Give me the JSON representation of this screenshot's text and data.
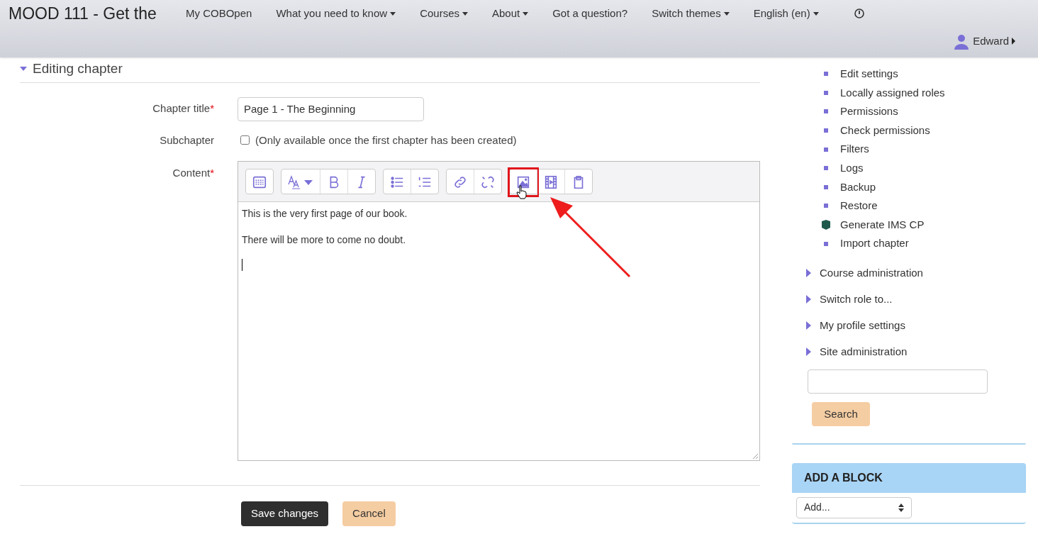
{
  "header": {
    "site_title": "MOOD 111 - Get the",
    "nav": [
      {
        "label": "My COBOpen",
        "dropdown": false
      },
      {
        "label": "What you need to know",
        "dropdown": true
      },
      {
        "label": "Courses",
        "dropdown": true
      },
      {
        "label": "About",
        "dropdown": true
      },
      {
        "label": "Got a question?",
        "dropdown": false
      },
      {
        "label": "Switch themes",
        "dropdown": true
      },
      {
        "label": "English (en)",
        "dropdown": true
      }
    ],
    "user": {
      "name": "Edward"
    }
  },
  "heading": "Editing chapter",
  "form": {
    "chapter_title": {
      "label": "Chapter title",
      "required_mark": "*",
      "value": "Page 1 - The Beginning"
    },
    "subchapter": {
      "label": "Subchapter",
      "checked": false,
      "note": "(Only available once the first chapter has been created)"
    },
    "content": {
      "label": "Content",
      "required_mark": "*",
      "toolbar": [
        [
          {
            "kind": "toggle",
            "highlighted": false
          }
        ],
        [
          {
            "kind": "style",
            "highlighted": false
          },
          {
            "kind": "bold",
            "highlighted": false
          },
          {
            "kind": "italic",
            "highlighted": false
          }
        ],
        [
          {
            "kind": "bullets",
            "highlighted": false
          },
          {
            "kind": "numbers",
            "highlighted": false
          }
        ],
        [
          {
            "kind": "link",
            "highlighted": false
          },
          {
            "kind": "unlink",
            "highlighted": false
          }
        ],
        [
          {
            "kind": "image",
            "highlighted": true
          },
          {
            "kind": "media",
            "highlighted": false
          },
          {
            "kind": "file",
            "highlighted": false
          }
        ]
      ],
      "paragraphs": [
        "This is the very first page of our book.",
        "There will be more to come no doubt."
      ]
    },
    "buttons": [
      {
        "label": "Save changes",
        "kind": "primary"
      },
      {
        "label": "Cancel",
        "kind": "secondary"
      }
    ]
  },
  "sidebar": {
    "items": [
      {
        "label": "Edit settings",
        "kind": "bullet"
      },
      {
        "label": "Locally assigned roles",
        "kind": "bullet"
      },
      {
        "label": "Permissions",
        "kind": "bullet"
      },
      {
        "label": "Check permissions",
        "kind": "bullet"
      },
      {
        "label": "Filters",
        "kind": "bullet"
      },
      {
        "label": "Logs",
        "kind": "bullet"
      },
      {
        "label": "Backup",
        "kind": "bullet"
      },
      {
        "label": "Restore",
        "kind": "bullet"
      },
      {
        "label": "Generate IMS CP",
        "kind": "package"
      },
      {
        "label": "Import chapter",
        "kind": "bullet"
      }
    ],
    "sections": [
      {
        "label": "Course administration",
        "expanded": false
      },
      {
        "label": "Switch role to...",
        "expanded": false
      },
      {
        "label": "My profile settings",
        "expanded": false
      },
      {
        "label": "Site administration",
        "expanded": false
      }
    ],
    "search_button": "Search",
    "add_block": {
      "title": "ADD A BLOCK",
      "select": "Add..."
    }
  }
}
